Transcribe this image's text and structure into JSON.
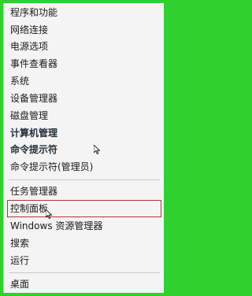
{
  "menu": {
    "group1": [
      "程序和功能",
      "网络连接",
      "电源选项",
      "事件查看器",
      "系统",
      "设备管理器",
      "磁盘管理",
      "计算机管理",
      "命令提示符",
      "命令提示符(管理员)"
    ],
    "group2": [
      "任务管理器",
      "控制面板",
      "Windows 资源管理器",
      "搜索",
      "运行"
    ],
    "group3": [
      "桌面"
    ]
  },
  "colors": {
    "frame_green": "#2fd12f",
    "menu_bg": "#f4f4f4",
    "highlight_border": "#b3363a"
  }
}
